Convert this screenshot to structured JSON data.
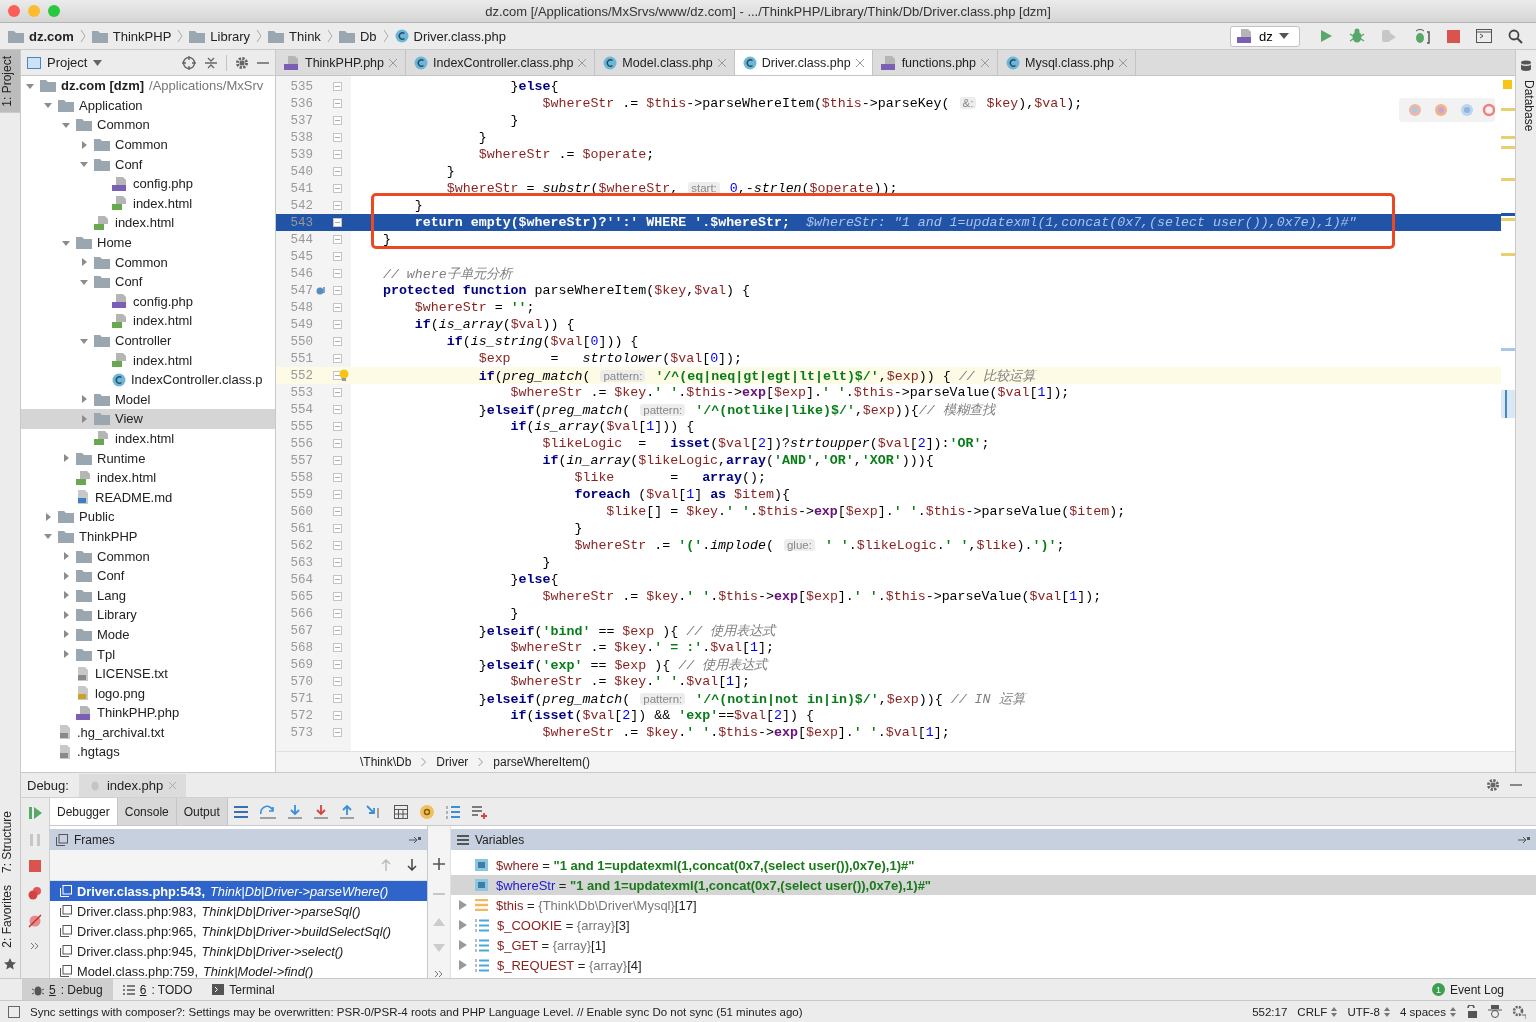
{
  "window": {
    "title": "dz.com [/Applications/MxSrvs/www/dz.com] - .../ThinkPHP/Library/Think/Db/Driver.class.php [dzm]"
  },
  "navbar": {
    "crumbs": [
      {
        "label": "dz.com",
        "kind": "folder"
      },
      {
        "label": "ThinkPHP",
        "kind": "folder"
      },
      {
        "label": "Library",
        "kind": "folder"
      },
      {
        "label": "Think",
        "kind": "folder"
      },
      {
        "label": "Db",
        "kind": "folder"
      },
      {
        "label": "Driver.class.php",
        "kind": "class"
      }
    ],
    "run_config": "dz"
  },
  "side_strip": {
    "top": [
      {
        "label": "1: Project",
        "selected": true
      }
    ],
    "bottom": [
      {
        "label": "7: Structure",
        "selected": false
      },
      {
        "label": "2: Favorites",
        "selected": false
      }
    ],
    "right": "Database"
  },
  "project": {
    "title": "Project",
    "tree": [
      {
        "label": "dz.com [dzm]",
        "path": "/Applications/MxSrv",
        "kind": "root",
        "expanded": true,
        "selected": false,
        "children": [
          {
            "label": "Application",
            "kind": "folder",
            "expanded": true,
            "selected": false,
            "children": [
              {
                "label": "Common",
                "kind": "folder",
                "expanded": true,
                "selected": false,
                "children": [
                  {
                    "label": "Common",
                    "kind": "folder",
                    "expanded": false,
                    "selected": false
                  },
                  {
                    "label": "Conf",
                    "kind": "folder",
                    "expanded": true,
                    "selected": false,
                    "children": [
                      {
                        "label": "config.php",
                        "kind": "php",
                        "selected": false
                      },
                      {
                        "label": "index.html",
                        "kind": "html",
                        "selected": false
                      }
                    ]
                  },
                  {
                    "label": "index.html",
                    "kind": "html",
                    "selected": false
                  }
                ]
              },
              {
                "label": "Home",
                "kind": "folder",
                "expanded": true,
                "selected": false,
                "children": [
                  {
                    "label": "Common",
                    "kind": "folder",
                    "expanded": false,
                    "selected": false
                  },
                  {
                    "label": "Conf",
                    "kind": "folder",
                    "expanded": true,
                    "selected": false,
                    "children": [
                      {
                        "label": "config.php",
                        "kind": "php",
                        "selected": false
                      },
                      {
                        "label": "index.html",
                        "kind": "html",
                        "selected": false
                      }
                    ]
                  },
                  {
                    "label": "Controller",
                    "kind": "folder",
                    "expanded": true,
                    "selected": false,
                    "children": [
                      {
                        "label": "index.html",
                        "kind": "html",
                        "selected": false
                      },
                      {
                        "label": "IndexController.class.p",
                        "kind": "class",
                        "selected": false
                      }
                    ]
                  },
                  {
                    "label": "Model",
                    "kind": "folder",
                    "expanded": false,
                    "selected": false
                  },
                  {
                    "label": "View",
                    "kind": "folder",
                    "expanded": false,
                    "selected": true
                  },
                  {
                    "label": "index.html",
                    "kind": "html",
                    "selected": false
                  }
                ]
              },
              {
                "label": "Runtime",
                "kind": "folder",
                "expanded": false,
                "selected": false
              },
              {
                "label": "index.html",
                "kind": "html",
                "selected": false
              },
              {
                "label": "README.md",
                "kind": "md",
                "selected": false
              }
            ]
          },
          {
            "label": "Public",
            "kind": "folder",
            "expanded": false,
            "selected": false
          },
          {
            "label": "ThinkPHP",
            "kind": "folder",
            "expanded": true,
            "selected": false,
            "children": [
              {
                "label": "Common",
                "kind": "folder",
                "expanded": false,
                "selected": false
              },
              {
                "label": "Conf",
                "kind": "folder",
                "expanded": false,
                "selected": false
              },
              {
                "label": "Lang",
                "kind": "folder",
                "expanded": false,
                "selected": false
              },
              {
                "label": "Library",
                "kind": "folder",
                "expanded": false,
                "selected": false
              },
              {
                "label": "Mode",
                "kind": "folder",
                "expanded": false,
                "selected": false
              },
              {
                "label": "Tpl",
                "kind": "folder",
                "expanded": false,
                "selected": false
              },
              {
                "label": "LICENSE.txt",
                "kind": "txt",
                "selected": false
              },
              {
                "label": "logo.png",
                "kind": "png",
                "selected": false
              },
              {
                "label": "ThinkPHP.php",
                "kind": "php",
                "selected": false
              }
            ]
          },
          {
            "label": ".hg_archival.txt",
            "kind": "txt",
            "selected": false
          },
          {
            "label": ".hgtags",
            "kind": "txt",
            "selected": false
          }
        ]
      }
    ]
  },
  "editor": {
    "tabs": [
      {
        "label": "ThinkPHP.php",
        "kind": "php",
        "selected": false
      },
      {
        "label": "IndexController.class.php",
        "kind": "class",
        "selected": false
      },
      {
        "label": "Model.class.php",
        "kind": "class",
        "selected": false
      },
      {
        "label": "Driver.class.php",
        "kind": "class",
        "selected": true
      },
      {
        "label": "functions.php",
        "kind": "php",
        "selected": false
      },
      {
        "label": "Mysql.class.php",
        "kind": "class",
        "selected": false
      }
    ],
    "lines": [
      {
        "num": "535",
        "current": false,
        "caret": false,
        "parts": [
          {
            "kind": "code",
            "text": "                    }else{"
          }
        ]
      },
      {
        "num": "536",
        "current": false,
        "caret": false,
        "parts": [
          {
            "kind": "code",
            "text": "                        $whereStr .= $this->parseWhereItem($this->parseKey( "
          },
          {
            "kind": "hint",
            "text": "&:"
          },
          {
            "kind": "code",
            "text": " $key),$val);"
          }
        ]
      },
      {
        "num": "537",
        "current": false,
        "caret": false,
        "parts": [
          {
            "kind": "code",
            "text": "                    }"
          }
        ]
      },
      {
        "num": "538",
        "current": false,
        "caret": false,
        "parts": [
          {
            "kind": "code",
            "text": "                }"
          }
        ]
      },
      {
        "num": "539",
        "current": false,
        "caret": false,
        "parts": [
          {
            "kind": "code",
            "text": "                $whereStr .= $operate;"
          }
        ]
      },
      {
        "num": "540",
        "current": false,
        "caret": false,
        "parts": [
          {
            "kind": "code",
            "text": "            }"
          }
        ]
      },
      {
        "num": "541",
        "current": false,
        "caret": false,
        "parts": [
          {
            "kind": "code",
            "text": "            $whereStr = substr($whereStr, "
          },
          {
            "kind": "hint",
            "text": "start:"
          },
          {
            "kind": "code",
            "text": " 0,-strlen($operate));"
          }
        ]
      },
      {
        "num": "542",
        "current": false,
        "caret": false,
        "parts": [
          {
            "kind": "code",
            "text": "        }"
          }
        ]
      },
      {
        "num": "543",
        "current": true,
        "caret": false,
        "parts": [
          {
            "kind": "code",
            "text": "        return empty($whereStr)?'':' WHERE '.$whereStr;"
          },
          {
            "kind": "value",
            "text": "$whereStr: \"1 and 1=updatexml(1,concat(0x7,(select user()),0x7e),1)#\""
          }
        ]
      },
      {
        "num": "544",
        "current": false,
        "caret": false,
        "parts": [
          {
            "kind": "code",
            "text": "    }"
          }
        ]
      },
      {
        "num": "545",
        "current": false,
        "caret": false
      },
      {
        "num": "546",
        "current": false,
        "caret": false,
        "parts": [
          {
            "kind": "code",
            "text": "    // where子单元分析"
          }
        ]
      },
      {
        "num": "547",
        "current": false,
        "caret": false,
        "kind": "override",
        "parts": [
          {
            "kind": "code",
            "text": "    protected function parseWhereItem($key,$val) {"
          }
        ]
      },
      {
        "num": "548",
        "current": false,
        "caret": false,
        "parts": [
          {
            "kind": "code",
            "text": "        $whereStr = '';"
          }
        ]
      },
      {
        "num": "549",
        "current": false,
        "caret": false,
        "parts": [
          {
            "kind": "code",
            "text": "        if(is_array($val)) {"
          }
        ]
      },
      {
        "num": "550",
        "current": false,
        "caret": false,
        "parts": [
          {
            "kind": "code",
            "text": "            if(is_string($val[0])) {"
          }
        ]
      },
      {
        "num": "551",
        "current": false,
        "caret": false,
        "parts": [
          {
            "kind": "code",
            "text": "                $exp     =   strtolower($val[0]);"
          }
        ]
      },
      {
        "num": "552",
        "current": false,
        "caret": true,
        "kind": "bulb",
        "parts": [
          {
            "kind": "code",
            "text": "                if(preg_match( "
          },
          {
            "kind": "hint",
            "text": "pattern:"
          },
          {
            "kind": "code",
            "text": " '/^(eq|neq|gt|egt|lt|elt)$/',$exp)) { // 比较运算"
          }
        ]
      },
      {
        "num": "553",
        "current": false,
        "caret": false,
        "parts": [
          {
            "kind": "code",
            "text": "                    $whereStr .= $key.' '.$this->exp[$exp].' '.$this->parseValue($val[1]);"
          }
        ]
      },
      {
        "num": "554",
        "current": false,
        "caret": false,
        "parts": [
          {
            "kind": "code",
            "text": "                }elseif(preg_match( "
          },
          {
            "kind": "hint",
            "text": "pattern:"
          },
          {
            "kind": "code",
            "text": " '/^(notlike|like)$/',$exp)){// 模糊查找"
          }
        ]
      },
      {
        "num": "555",
        "current": false,
        "caret": false,
        "parts": [
          {
            "kind": "code",
            "text": "                    if(is_array($val[1])) {"
          }
        ]
      },
      {
        "num": "556",
        "current": false,
        "caret": false,
        "parts": [
          {
            "kind": "code",
            "text": "                        $likeLogic  =   isset($val[2])?strtoupper($val[2]):'OR';"
          }
        ]
      },
      {
        "num": "557",
        "current": false,
        "caret": false,
        "parts": [
          {
            "kind": "code",
            "text": "                        if(in_array($likeLogic,array('AND','OR','XOR'))){"
          }
        ]
      },
      {
        "num": "558",
        "current": false,
        "caret": false,
        "parts": [
          {
            "kind": "code",
            "text": "                            $like       =   array();"
          }
        ]
      },
      {
        "num": "559",
        "current": false,
        "caret": false,
        "parts": [
          {
            "kind": "code",
            "text": "                            foreach ($val[1] as $item){"
          }
        ]
      },
      {
        "num": "560",
        "current": false,
        "caret": false,
        "parts": [
          {
            "kind": "code",
            "text": "                                $like[] = $key.' '.$this->exp[$exp].' '.$this->parseValue($item);"
          }
        ]
      },
      {
        "num": "561",
        "current": false,
        "caret": false,
        "parts": [
          {
            "kind": "code",
            "text": "                            }"
          }
        ]
      },
      {
        "num": "562",
        "current": false,
        "caret": false,
        "parts": [
          {
            "kind": "code",
            "text": "                            $whereStr .= '('.implode( "
          },
          {
            "kind": "hint",
            "text": "glue:"
          },
          {
            "kind": "code",
            "text": " ' '.$likeLogic.' ',$like).')';"
          }
        ]
      },
      {
        "num": "563",
        "current": false,
        "caret": false,
        "parts": [
          {
            "kind": "code",
            "text": "                        }"
          }
        ]
      },
      {
        "num": "564",
        "current": false,
        "caret": false,
        "parts": [
          {
            "kind": "code",
            "text": "                    }else{"
          }
        ]
      },
      {
        "num": "565",
        "current": false,
        "caret": false,
        "parts": [
          {
            "kind": "code",
            "text": "                        $whereStr .= $key.' '.$this->exp[$exp].' '.$this->parseValue($val[1]);"
          }
        ]
      },
      {
        "num": "566",
        "current": false,
        "caret": false,
        "parts": [
          {
            "kind": "code",
            "text": "                    }"
          }
        ]
      },
      {
        "num": "567",
        "current": false,
        "caret": false,
        "parts": [
          {
            "kind": "code",
            "text": "                }elseif('bind' == $exp ){ // 使用表达式"
          }
        ]
      },
      {
        "num": "568",
        "current": false,
        "caret": false,
        "parts": [
          {
            "kind": "code",
            "text": "                    $whereStr .= $key.' = :'.$val[1];"
          }
        ]
      },
      {
        "num": "569",
        "current": false,
        "caret": false,
        "parts": [
          {
            "kind": "code",
            "text": "                }elseif('exp' == $exp ){ // 使用表达式"
          }
        ]
      },
      {
        "num": "570",
        "current": false,
        "caret": false,
        "parts": [
          {
            "kind": "code",
            "text": "                    $whereStr .= $key.' '.$val[1];"
          }
        ]
      },
      {
        "num": "571",
        "current": false,
        "caret": false,
        "parts": [
          {
            "kind": "code",
            "text": "                }elseif(preg_match( "
          },
          {
            "kind": "hint",
            "text": "pattern:"
          },
          {
            "kind": "code",
            "text": " '/^(notin|not in|in)$/',$exp)){ // IN 运算"
          }
        ]
      },
      {
        "num": "572",
        "current": false,
        "caret": false,
        "parts": [
          {
            "kind": "code",
            "text": "                    if(isset($val[2]) && 'exp'==$val[2]) {"
          }
        ]
      },
      {
        "num": "573",
        "current": false,
        "caret": false,
        "parts": [
          {
            "kind": "code",
            "text": "                        $whereStr .= $key.' '.$this->exp[$exp].' '.$val[1];"
          }
        ]
      }
    ],
    "breadcrumb": [
      "\\Think\\Db",
      "Driver",
      "parseWhereItem()"
    ]
  },
  "debug": {
    "label": "Debug:",
    "session": "index.php",
    "tabs": [
      {
        "label": "Debugger",
        "selected": true
      },
      {
        "label": "Console",
        "selected": false
      },
      {
        "label": "Output",
        "selected": false
      }
    ],
    "frames_title": "Frames",
    "variables_title": "Variables",
    "frames": [
      {
        "location": "Driver.class.php:543,",
        "method": "Think|Db|Driver->parseWhere()",
        "selected": true
      },
      {
        "location": "Driver.class.php:983,",
        "method": "Think|Db|Driver->parseSql()",
        "selected": false
      },
      {
        "location": "Driver.class.php:965,",
        "method": "Think|Db|Driver->buildSelectSql()",
        "selected": false
      },
      {
        "location": "Driver.class.php:945,",
        "method": "Think|Db|Driver->select()",
        "selected": false
      },
      {
        "location": "Model.class.php:759,",
        "method": "Think|Model->find()",
        "selected": false
      }
    ],
    "variables": [
      {
        "name": "$where",
        "eq": "=",
        "value": "\"1 and 1=updatexml(1,concat(0x7,(select user()),0x7e),1)#\"",
        "kind": "string",
        "selected": false
      },
      {
        "name": "$whereStr",
        "eq": "=",
        "value": "\"1 and 1=updatexml(1,concat(0x7,(select user()),0x7e),1)#\"",
        "kind": "string",
        "selected": true
      },
      {
        "name": "$this",
        "eq": "=",
        "value": "{Think\\Db\\Driver\\Mysql}",
        "count": "[17]",
        "kind": "object",
        "selected": false
      },
      {
        "name": "$_COOKIE",
        "eq": "=",
        "value": "{array}",
        "count": "[3]",
        "kind": "array",
        "selected": false
      },
      {
        "name": "$_GET",
        "eq": "=",
        "value": "{array}",
        "count": "[1]",
        "kind": "array",
        "selected": false
      },
      {
        "name": "$_REQUEST",
        "eq": "=",
        "value": "{array}",
        "count": "[4]",
        "kind": "array",
        "selected": false
      }
    ]
  },
  "toolwindows": [
    {
      "number": "5",
      "label": ": Debug",
      "kind": "debug",
      "selected": true
    },
    {
      "number": "6",
      "label": ": TODO",
      "kind": "todo",
      "selected": false
    },
    {
      "label": "Terminal",
      "kind": "terminal",
      "selected": false
    }
  ],
  "event_log": {
    "label": "Event Log",
    "count": "1"
  },
  "status_bar": {
    "message": "Sync settings with composer?: Settings may be overwritten: PSR-0/PSR-4 roots and PHP Language Level. // Enable sync Do not sync (51 minutes ago)",
    "position": "552:17",
    "line_sep": "CRLF",
    "encoding": "UTF-8",
    "indent": "4 spaces"
  }
}
